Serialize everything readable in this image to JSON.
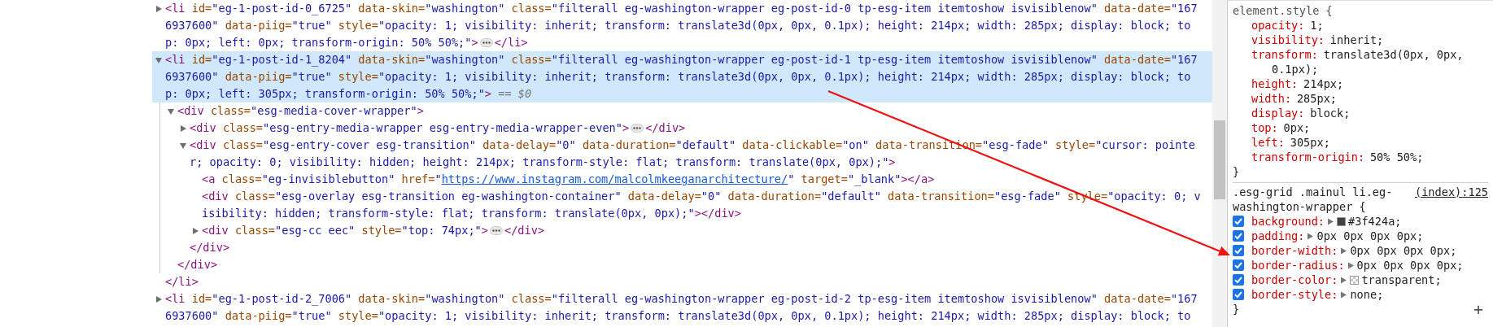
{
  "elements": {
    "nodes": [
      {
        "selected": false,
        "expanded": false,
        "lines": [
          [
            {
              "kind": "tag",
              "text": "<li"
            },
            {
              "kind": "attr",
              "text": " id="
            },
            {
              "kind": "value",
              "text": "\"eg-1-post-id-0_6725\""
            },
            {
              "kind": "attr",
              "text": " data-skin="
            },
            {
              "kind": "value",
              "text": "\"washington\""
            },
            {
              "kind": "attr",
              "text": " class="
            },
            {
              "kind": "value",
              "text": "\"filterall eg-washington-wrapper eg-post-id-0 tp-esg-item itemtoshow isvisiblenow\""
            },
            {
              "kind": "attr",
              "text": " data-date="
            },
            {
              "kind": "value",
              "text": "\"167"
            }
          ],
          [
            {
              "kind": "value",
              "text": "6937600\""
            },
            {
              "kind": "attr",
              "text": " data-piig="
            },
            {
              "kind": "value",
              "text": "\"true\""
            },
            {
              "kind": "attr",
              "text": " style="
            },
            {
              "kind": "value",
              "text": "\"opacity: 1; visibility: inherit; transform: translate3d(0px, 0px, 0.1px); height: 214px; width: 285px; display: block; to"
            }
          ],
          [
            {
              "kind": "value",
              "text": "p: 0px; left: 0px; transform-origin: 50% 50%;\""
            },
            {
              "kind": "tag",
              "text": ">"
            },
            {
              "kind": "ellipsis"
            },
            {
              "kind": "tag",
              "text": "</li>"
            }
          ]
        ]
      },
      {
        "selected": true,
        "expanded": true,
        "lines": [
          [
            {
              "kind": "tag",
              "text": "<li"
            },
            {
              "kind": "attr",
              "text": " id="
            },
            {
              "kind": "value",
              "text": "\"eg-1-post-id-1_8204\""
            },
            {
              "kind": "attr",
              "text": " data-skin="
            },
            {
              "kind": "value",
              "text": "\"washington\""
            },
            {
              "kind": "attr",
              "text": " class="
            },
            {
              "kind": "value",
              "text": "\"filterall eg-washington-wrapper eg-post-id-1 tp-esg-item itemtoshow isvisiblenow\""
            },
            {
              "kind": "attr",
              "text": " data-date="
            },
            {
              "kind": "value",
              "text": "\"167"
            }
          ],
          [
            {
              "kind": "value",
              "text": "6937600\""
            },
            {
              "kind": "attr",
              "text": " data-piig="
            },
            {
              "kind": "value",
              "text": "\"true\""
            },
            {
              "kind": "attr",
              "text": " style="
            },
            {
              "kind": "value",
              "text": "\"opacity: 1; visibility: inherit; transform: translate3d(0px, 0px, 0.1px); height: 214px; width: 285px; display: block; to"
            }
          ],
          [
            {
              "kind": "value",
              "text": "p: 0px; left: 305px; transform-origin: 50% 50%;\""
            },
            {
              "kind": "tag",
              "text": ">"
            },
            {
              "kind": "dim",
              "text": " == $0"
            }
          ]
        ],
        "children": [
          {
            "selected": false,
            "expanded": true,
            "lines": [
              [
                {
                  "kind": "tag",
                  "text": "<div"
                },
                {
                  "kind": "attr",
                  "text": " class="
                },
                {
                  "kind": "value",
                  "text": "\"esg-media-cover-wrapper\""
                },
                {
                  "kind": "tag",
                  "text": ">"
                }
              ]
            ],
            "children": [
              {
                "selected": false,
                "expanded": false,
                "lines": [
                  [
                    {
                      "kind": "tag",
                      "text": "<div"
                    },
                    {
                      "kind": "attr",
                      "text": " class="
                    },
                    {
                      "kind": "value",
                      "text": "\"esg-entry-media-wrapper esg-entry-media-wrapper-even\""
                    },
                    {
                      "kind": "tag",
                      "text": ">"
                    },
                    {
                      "kind": "ellipsis"
                    },
                    {
                      "kind": "tag",
                      "text": "</div>"
                    }
                  ]
                ]
              },
              {
                "selected": false,
                "expanded": true,
                "lines": [
                  [
                    {
                      "kind": "tag",
                      "text": "<div"
                    },
                    {
                      "kind": "attr",
                      "text": " class="
                    },
                    {
                      "kind": "value",
                      "text": "\"esg-entry-cover esg-transition\""
                    },
                    {
                      "kind": "attr",
                      "text": " data-delay="
                    },
                    {
                      "kind": "value",
                      "text": "\"0\""
                    },
                    {
                      "kind": "attr",
                      "text": " data-duration="
                    },
                    {
                      "kind": "value",
                      "text": "\"default\""
                    },
                    {
                      "kind": "attr",
                      "text": " data-clickable="
                    },
                    {
                      "kind": "value",
                      "text": "\"on\""
                    },
                    {
                      "kind": "attr",
                      "text": " data-transition="
                    },
                    {
                      "kind": "value",
                      "text": "\"esg-fade\""
                    },
                    {
                      "kind": "attr",
                      "text": " style="
                    },
                    {
                      "kind": "value",
                      "text": "\"cursor: pointe"
                    }
                  ],
                  [
                    {
                      "kind": "value",
                      "text": "r; opacity: 0; visibility: hidden; height: 214px; transform-style: flat; transform: translate(0px, 0px);\""
                    },
                    {
                      "kind": "tag",
                      "text": ">"
                    }
                  ]
                ],
                "children": [
                  {
                    "selected": false,
                    "lines": [
                      [
                        {
                          "kind": "tag",
                          "text": "<a"
                        },
                        {
                          "kind": "attr",
                          "text": " class="
                        },
                        {
                          "kind": "value",
                          "text": "\"eg-invisiblebutton\""
                        },
                        {
                          "kind": "attr",
                          "text": " href="
                        },
                        {
                          "kind": "value",
                          "text": "\""
                        },
                        {
                          "kind": "link",
                          "text": "https://www.instagram.com/malcolmkeeganarchitecture/"
                        },
                        {
                          "kind": "value",
                          "text": "\""
                        },
                        {
                          "kind": "attr",
                          "text": " target="
                        },
                        {
                          "kind": "value",
                          "text": "\"_blank\""
                        },
                        {
                          "kind": "tag",
                          "text": "></a>"
                        }
                      ]
                    ]
                  },
                  {
                    "selected": false,
                    "lines": [
                      [
                        {
                          "kind": "tag",
                          "text": "<div"
                        },
                        {
                          "kind": "attr",
                          "text": " class="
                        },
                        {
                          "kind": "value",
                          "text": "\"esg-overlay esg-transition eg-washington-container\""
                        },
                        {
                          "kind": "attr",
                          "text": " data-delay="
                        },
                        {
                          "kind": "value",
                          "text": "\"0\""
                        },
                        {
                          "kind": "attr",
                          "text": " data-duration="
                        },
                        {
                          "kind": "value",
                          "text": "\"default\""
                        },
                        {
                          "kind": "attr",
                          "text": " data-transition="
                        },
                        {
                          "kind": "value",
                          "text": "\"esg-fade\""
                        },
                        {
                          "kind": "attr",
                          "text": " style="
                        },
                        {
                          "kind": "value",
                          "text": "\"opacity: 0; v"
                        }
                      ],
                      [
                        {
                          "kind": "value",
                          "text": "isibility: hidden; transform-style: flat; transform: translate(0px, 0px);\""
                        },
                        {
                          "kind": "tag",
                          "text": "></div>"
                        }
                      ]
                    ]
                  },
                  {
                    "selected": false,
                    "expanded": false,
                    "lines": [
                      [
                        {
                          "kind": "tag",
                          "text": "<div"
                        },
                        {
                          "kind": "attr",
                          "text": " class="
                        },
                        {
                          "kind": "value",
                          "text": "\"esg-cc eec\""
                        },
                        {
                          "kind": "attr",
                          "text": " style="
                        },
                        {
                          "kind": "value",
                          "text": "\"top: 74px;\""
                        },
                        {
                          "kind": "tag",
                          "text": ">"
                        },
                        {
                          "kind": "ellipsis"
                        },
                        {
                          "kind": "tag",
                          "text": "</div>"
                        }
                      ]
                    ]
                  }
                ],
                "closing": [
                  {
                    "kind": "tag",
                    "text": "</div>"
                  }
                ]
              }
            ],
            "closing": [
              {
                "kind": "tag",
                "text": "</div>"
              }
            ]
          }
        ],
        "closing": [
          {
            "kind": "tag",
            "text": "</li>"
          }
        ]
      },
      {
        "selected": false,
        "expanded": false,
        "lines": [
          [
            {
              "kind": "tag",
              "text": "<li"
            },
            {
              "kind": "attr",
              "text": " id="
            },
            {
              "kind": "value",
              "text": "\"eg-1-post-id-2_7006\""
            },
            {
              "kind": "attr",
              "text": " data-skin="
            },
            {
              "kind": "value",
              "text": "\"washington\""
            },
            {
              "kind": "attr",
              "text": " class="
            },
            {
              "kind": "value",
              "text": "\"filterall eg-washington-wrapper eg-post-id-2 tp-esg-item itemtoshow isvisiblenow\""
            },
            {
              "kind": "attr",
              "text": " data-date="
            },
            {
              "kind": "value",
              "text": "\"167"
            }
          ],
          [
            {
              "kind": "value",
              "text": "6937600\""
            },
            {
              "kind": "attr",
              "text": " data-piig="
            },
            {
              "kind": "value",
              "text": "\"true\""
            },
            {
              "kind": "attr",
              "text": " style="
            },
            {
              "kind": "value",
              "text": "\"opacity: 1; visibility: inherit; transform: translate3d(0px, 0px, 0.1px); height: 214px; width: 285px; display: block; to"
            }
          ]
        ]
      }
    ]
  },
  "styles": {
    "rules": [
      {
        "selector": "element.style {",
        "closing": "}",
        "declarations": [
          {
            "kind": "plain",
            "property": "opacity:",
            "value": "1;"
          },
          {
            "kind": "plain",
            "property": "visibility:",
            "value": "inherit;"
          },
          {
            "kind": "plain",
            "property": "transform:",
            "value": "translate3d(0px, 0px, 0.1px);"
          },
          {
            "kind": "plain",
            "property": "height:",
            "value": "214px;"
          },
          {
            "kind": "plain",
            "property": "width:",
            "value": "285px;"
          },
          {
            "kind": "plain",
            "property": "display:",
            "value": "block;"
          },
          {
            "kind": "plain",
            "property": "top:",
            "value": "0px;"
          },
          {
            "kind": "plain",
            "property": "left:",
            "value": "305px;"
          },
          {
            "kind": "plain",
            "property": "transform-origin:",
            "value": "50% 50%;"
          }
        ]
      },
      {
        "selector": ".esg-grid .mainul li.eg-washington-wrapper {",
        "source": "(index):125",
        "closing": "}",
        "declarations": [
          {
            "kind": "color",
            "color": "#3f424a",
            "checked": true,
            "expandable": true,
            "property": "background:",
            "value": "#3f424a;"
          },
          {
            "kind": "plain",
            "checked": true,
            "expandable": true,
            "property": "padding:",
            "value": "0px 0px 0px 0px;"
          },
          {
            "kind": "plain",
            "checked": true,
            "expandable": true,
            "property": "border-width:",
            "value": "0px 0px 0px 0px;"
          },
          {
            "kind": "plain",
            "checked": true,
            "expandable": true,
            "property": "border-radius:",
            "value": "0px 0px 0px 0px;"
          },
          {
            "kind": "transparent",
            "checked": true,
            "expandable": true,
            "property": "border-color:",
            "value": "transparent;"
          },
          {
            "kind": "plain",
            "checked": true,
            "expandable": true,
            "property": "border-style:",
            "value": "none;"
          }
        ]
      }
    ],
    "new_rule_button": "+"
  }
}
